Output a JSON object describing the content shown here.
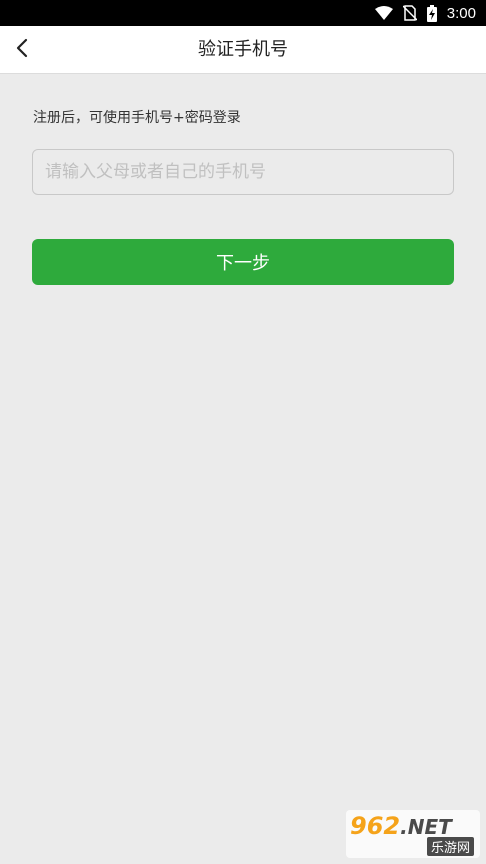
{
  "status_bar": {
    "time": "3:00",
    "icons": [
      "wifi-icon",
      "no-sim-icon",
      "battery-charging-icon"
    ]
  },
  "nav": {
    "title": "验证手机号",
    "back_icon": "chevron-left-icon"
  },
  "form": {
    "hint": "注册后，可使用手机号+密码登录",
    "phone_placeholder": "请输入父母或者自己的手机号",
    "phone_value": "",
    "next_label": "下一步"
  },
  "watermark": {
    "number": "962",
    "domain": ".NET",
    "site_name": "乐游网"
  },
  "colors": {
    "background": "#ebebeb",
    "primary_button": "#2eaa3c",
    "nav_background": "#ffffff",
    "status_bar": "#000000"
  }
}
